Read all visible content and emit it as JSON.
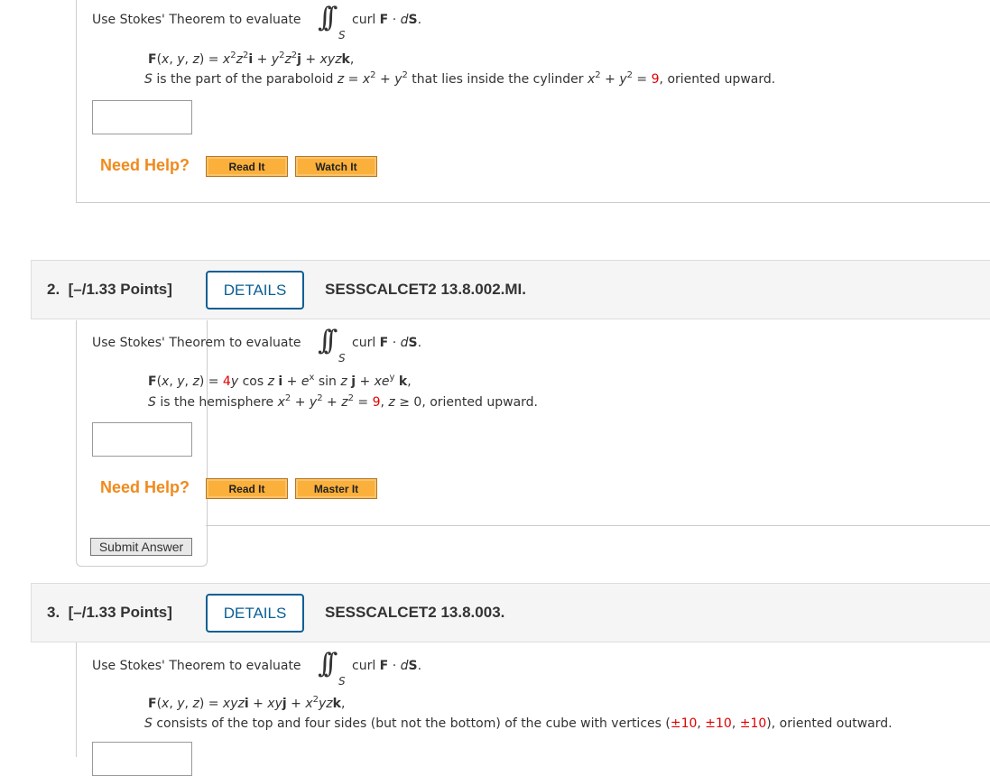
{
  "colors": {
    "accent": "#0b5f94",
    "help": "#f08a1c",
    "button": "#fbb03b",
    "highlight": "#e00000"
  },
  "common": {
    "prompt": "Use Stokes' Theorem to evaluate",
    "integral_symbol": "∫∫",
    "integral_sub": "S",
    "integrand": [
      {
        "t": "curl "
      },
      {
        "t": "F",
        "s": "b"
      },
      {
        "t": " · "
      },
      {
        "t": "d",
        "s": "i"
      },
      {
        "t": "S",
        "s": "b"
      },
      {
        "t": "."
      }
    ],
    "need_help": "Need Help?",
    "read_it": "Read It",
    "watch_it": "Watch It",
    "master_it": "Master It",
    "details": "DETAILS",
    "submit": "Submit Answer"
  },
  "questions": [
    {
      "field": [
        {
          "t": "F",
          "s": "b"
        },
        {
          "t": "("
        },
        {
          "t": "x",
          "s": "i"
        },
        {
          "t": ", "
        },
        {
          "t": "y",
          "s": "i"
        },
        {
          "t": ", "
        },
        {
          "t": "z",
          "s": "i"
        },
        {
          "t": ") = "
        },
        {
          "t": "x",
          "s": "i"
        },
        {
          "t": "2",
          "s": "sup"
        },
        {
          "t": "z",
          "s": "i"
        },
        {
          "t": "2",
          "s": "sup"
        },
        {
          "t": "i",
          "s": "b"
        },
        {
          "t": " + "
        },
        {
          "t": "y",
          "s": "i"
        },
        {
          "t": "2",
          "s": "sup"
        },
        {
          "t": "z",
          "s": "i"
        },
        {
          "t": "2",
          "s": "sup"
        },
        {
          "t": "j",
          "s": "b"
        },
        {
          "t": " + "
        },
        {
          "t": "xyz",
          "s": "i"
        },
        {
          "t": "k",
          "s": "b"
        },
        {
          "t": ","
        }
      ],
      "surface": [
        {
          "t": "S",
          "s": "i"
        },
        {
          "t": " is the part of the paraboloid  "
        },
        {
          "t": "z",
          "s": "i"
        },
        {
          "t": " = "
        },
        {
          "t": "x",
          "s": "i"
        },
        {
          "t": "2",
          "s": "sup"
        },
        {
          "t": " + "
        },
        {
          "t": "y",
          "s": "i"
        },
        {
          "t": "2",
          "s": "sup"
        },
        {
          "t": "  that lies inside the cylinder  "
        },
        {
          "t": "x",
          "s": "i"
        },
        {
          "t": "2",
          "s": "sup"
        },
        {
          "t": " + "
        },
        {
          "t": "y",
          "s": "i"
        },
        {
          "t": "2",
          "s": "sup"
        },
        {
          "t": " = "
        },
        {
          "t": "9",
          "s": "r"
        },
        {
          "t": ",  oriented upward."
        }
      ],
      "answer": ""
    },
    {
      "number": "2.",
      "points": "[–/1.33 Points]",
      "id": "SESSCALCET2 13.8.002.MI.",
      "field": [
        {
          "t": "F",
          "s": "b"
        },
        {
          "t": "("
        },
        {
          "t": "x",
          "s": "i"
        },
        {
          "t": ", "
        },
        {
          "t": "y",
          "s": "i"
        },
        {
          "t": ", "
        },
        {
          "t": "z",
          "s": "i"
        },
        {
          "t": ") = "
        },
        {
          "t": "4",
          "s": "r"
        },
        {
          "t": "y",
          "s": "i"
        },
        {
          "t": " cos "
        },
        {
          "t": "z",
          "s": "i"
        },
        {
          "t": " "
        },
        {
          "t": "i",
          "s": "b"
        },
        {
          "t": " + "
        },
        {
          "t": "e",
          "s": "i"
        },
        {
          "t": "x",
          "s": "sup"
        },
        {
          "t": " sin "
        },
        {
          "t": "z",
          "s": "i"
        },
        {
          "t": " "
        },
        {
          "t": "j",
          "s": "b"
        },
        {
          "t": " + "
        },
        {
          "t": "xe",
          "s": "i"
        },
        {
          "t": "y",
          "s": "sup"
        },
        {
          "t": " "
        },
        {
          "t": "k",
          "s": "b"
        },
        {
          "t": ","
        }
      ],
      "surface": [
        {
          "t": "S",
          "s": "i"
        },
        {
          "t": " is the hemisphere "
        },
        {
          "t": "x",
          "s": "i"
        },
        {
          "t": "2",
          "s": "sup"
        },
        {
          "t": " + "
        },
        {
          "t": "y",
          "s": "i"
        },
        {
          "t": "2",
          "s": "sup"
        },
        {
          "t": " + "
        },
        {
          "t": "z",
          "s": "i"
        },
        {
          "t": "2",
          "s": "sup"
        },
        {
          "t": " = "
        },
        {
          "t": "9",
          "s": "r"
        },
        {
          "t": ", "
        },
        {
          "t": "z",
          "s": "i"
        },
        {
          "t": " ≥ 0, oriented upward."
        }
      ],
      "answer": ""
    },
    {
      "number": "3.",
      "points": "[–/1.33 Points]",
      "id": "SESSCALCET2 13.8.003.",
      "field": [
        {
          "t": "F",
          "s": "b"
        },
        {
          "t": "("
        },
        {
          "t": "x",
          "s": "i"
        },
        {
          "t": ", "
        },
        {
          "t": "y",
          "s": "i"
        },
        {
          "t": ", "
        },
        {
          "t": "z",
          "s": "i"
        },
        {
          "t": ") = "
        },
        {
          "t": "xyz",
          "s": "i"
        },
        {
          "t": "i",
          "s": "b"
        },
        {
          "t": " + "
        },
        {
          "t": "xy",
          "s": "i"
        },
        {
          "t": "j",
          "s": "b"
        },
        {
          "t": " + "
        },
        {
          "t": "x",
          "s": "i"
        },
        {
          "t": "2",
          "s": "sup"
        },
        {
          "t": "yz",
          "s": "i"
        },
        {
          "t": "k",
          "s": "b"
        },
        {
          "t": ","
        }
      ],
      "surface": [
        {
          "t": "S",
          "s": "i"
        },
        {
          "t": " consists of the top and four sides (but not the bottom) of the cube with vertices ("
        },
        {
          "t": "±10",
          "s": "r"
        },
        {
          "t": ", "
        },
        {
          "t": "±10",
          "s": "r"
        },
        {
          "t": ", "
        },
        {
          "t": "±10",
          "s": "r"
        },
        {
          "t": "), oriented outward."
        }
      ],
      "answer": ""
    }
  ]
}
